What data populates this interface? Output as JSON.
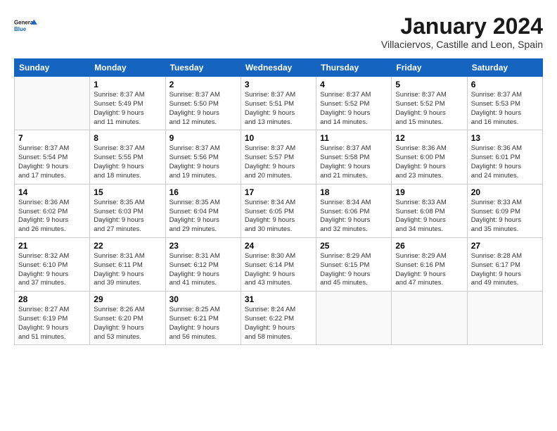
{
  "logo": {
    "line1": "General",
    "line2": "Blue"
  },
  "title": "January 2024",
  "subtitle": "Villaciervos, Castille and Leon, Spain",
  "days_header": [
    "Sunday",
    "Monday",
    "Tuesday",
    "Wednesday",
    "Thursday",
    "Friday",
    "Saturday"
  ],
  "weeks": [
    [
      {
        "num": "",
        "info": ""
      },
      {
        "num": "1",
        "info": "Sunrise: 8:37 AM\nSunset: 5:49 PM\nDaylight: 9 hours\nand 11 minutes."
      },
      {
        "num": "2",
        "info": "Sunrise: 8:37 AM\nSunset: 5:50 PM\nDaylight: 9 hours\nand 12 minutes."
      },
      {
        "num": "3",
        "info": "Sunrise: 8:37 AM\nSunset: 5:51 PM\nDaylight: 9 hours\nand 13 minutes."
      },
      {
        "num": "4",
        "info": "Sunrise: 8:37 AM\nSunset: 5:52 PM\nDaylight: 9 hours\nand 14 minutes."
      },
      {
        "num": "5",
        "info": "Sunrise: 8:37 AM\nSunset: 5:52 PM\nDaylight: 9 hours\nand 15 minutes."
      },
      {
        "num": "6",
        "info": "Sunrise: 8:37 AM\nSunset: 5:53 PM\nDaylight: 9 hours\nand 16 minutes."
      }
    ],
    [
      {
        "num": "7",
        "info": "Sunrise: 8:37 AM\nSunset: 5:54 PM\nDaylight: 9 hours\nand 17 minutes."
      },
      {
        "num": "8",
        "info": "Sunrise: 8:37 AM\nSunset: 5:55 PM\nDaylight: 9 hours\nand 18 minutes."
      },
      {
        "num": "9",
        "info": "Sunrise: 8:37 AM\nSunset: 5:56 PM\nDaylight: 9 hours\nand 19 minutes."
      },
      {
        "num": "10",
        "info": "Sunrise: 8:37 AM\nSunset: 5:57 PM\nDaylight: 9 hours\nand 20 minutes."
      },
      {
        "num": "11",
        "info": "Sunrise: 8:37 AM\nSunset: 5:58 PM\nDaylight: 9 hours\nand 21 minutes."
      },
      {
        "num": "12",
        "info": "Sunrise: 8:36 AM\nSunset: 6:00 PM\nDaylight: 9 hours\nand 23 minutes."
      },
      {
        "num": "13",
        "info": "Sunrise: 8:36 AM\nSunset: 6:01 PM\nDaylight: 9 hours\nand 24 minutes."
      }
    ],
    [
      {
        "num": "14",
        "info": "Sunrise: 8:36 AM\nSunset: 6:02 PM\nDaylight: 9 hours\nand 26 minutes."
      },
      {
        "num": "15",
        "info": "Sunrise: 8:35 AM\nSunset: 6:03 PM\nDaylight: 9 hours\nand 27 minutes."
      },
      {
        "num": "16",
        "info": "Sunrise: 8:35 AM\nSunset: 6:04 PM\nDaylight: 9 hours\nand 29 minutes."
      },
      {
        "num": "17",
        "info": "Sunrise: 8:34 AM\nSunset: 6:05 PM\nDaylight: 9 hours\nand 30 minutes."
      },
      {
        "num": "18",
        "info": "Sunrise: 8:34 AM\nSunset: 6:06 PM\nDaylight: 9 hours\nand 32 minutes."
      },
      {
        "num": "19",
        "info": "Sunrise: 8:33 AM\nSunset: 6:08 PM\nDaylight: 9 hours\nand 34 minutes."
      },
      {
        "num": "20",
        "info": "Sunrise: 8:33 AM\nSunset: 6:09 PM\nDaylight: 9 hours\nand 35 minutes."
      }
    ],
    [
      {
        "num": "21",
        "info": "Sunrise: 8:32 AM\nSunset: 6:10 PM\nDaylight: 9 hours\nand 37 minutes."
      },
      {
        "num": "22",
        "info": "Sunrise: 8:31 AM\nSunset: 6:11 PM\nDaylight: 9 hours\nand 39 minutes."
      },
      {
        "num": "23",
        "info": "Sunrise: 8:31 AM\nSunset: 6:12 PM\nDaylight: 9 hours\nand 41 minutes."
      },
      {
        "num": "24",
        "info": "Sunrise: 8:30 AM\nSunset: 6:14 PM\nDaylight: 9 hours\nand 43 minutes."
      },
      {
        "num": "25",
        "info": "Sunrise: 8:29 AM\nSunset: 6:15 PM\nDaylight: 9 hours\nand 45 minutes."
      },
      {
        "num": "26",
        "info": "Sunrise: 8:29 AM\nSunset: 6:16 PM\nDaylight: 9 hours\nand 47 minutes."
      },
      {
        "num": "27",
        "info": "Sunrise: 8:28 AM\nSunset: 6:17 PM\nDaylight: 9 hours\nand 49 minutes."
      }
    ],
    [
      {
        "num": "28",
        "info": "Sunrise: 8:27 AM\nSunset: 6:19 PM\nDaylight: 9 hours\nand 51 minutes."
      },
      {
        "num": "29",
        "info": "Sunrise: 8:26 AM\nSunset: 6:20 PM\nDaylight: 9 hours\nand 53 minutes."
      },
      {
        "num": "30",
        "info": "Sunrise: 8:25 AM\nSunset: 6:21 PM\nDaylight: 9 hours\nand 56 minutes."
      },
      {
        "num": "31",
        "info": "Sunrise: 8:24 AM\nSunset: 6:22 PM\nDaylight: 9 hours\nand 58 minutes."
      },
      {
        "num": "",
        "info": ""
      },
      {
        "num": "",
        "info": ""
      },
      {
        "num": "",
        "info": ""
      }
    ]
  ]
}
